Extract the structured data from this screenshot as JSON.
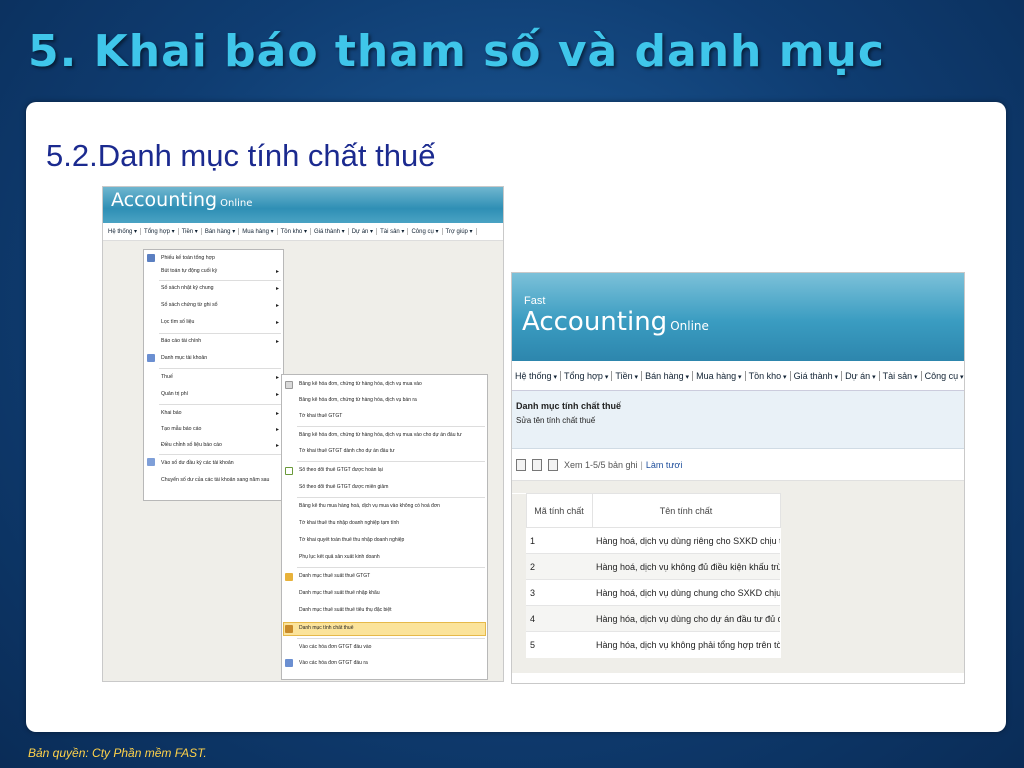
{
  "slide": {
    "title": "5. Khai báo tham số và danh mục",
    "subtitle": "5.2.Danh mục tính chất thuế",
    "footer": "Bản quyền: Cty Phần mềm FAST."
  },
  "app": {
    "brand": "Accounting",
    "brand_suffix": "Online",
    "fast_label": "Fast"
  },
  "menu": {
    "items": [
      "Hệ thống",
      "Tổng hợp",
      "Tiền",
      "Bán hàng",
      "Mua hàng",
      "Tồn kho",
      "Giá thành",
      "Dự án",
      "Tài sản",
      "Công cụ",
      "Trợ giúp"
    ]
  },
  "submenu_tonghop": [
    "Phiếu kế toán tổng hợp",
    "Bút toán tự động cuối kỳ",
    "Sổ sách nhật ký chung",
    "Sổ sách chứng từ ghi sổ",
    "Lọc tìm số liệu",
    "Báo cáo tài chính",
    "Danh mục tài khoản",
    "Thuế",
    "Quản trị phí",
    "Khai báo",
    "Tạo mẫu báo cáo",
    "Điều chỉnh số liệu báo cáo",
    "Vào số dư đầu kỳ các tài khoản",
    "Chuyển số dư của các tài khoản sang năm sau"
  ],
  "submenu_thue": [
    "Bảng kê hóa đơn, chứng từ hàng hóa, dịch vụ mua vào",
    "Bảng kê hóa đơn, chứng từ hàng hóa, dịch vụ bán ra",
    "Tờ khai thuế GTGT",
    "Bảng kê hóa đơn, chứng từ hàng hóa, dịch vụ mua vào cho dự án đầu tư",
    "Tờ khai thuế GTGT dành cho dự án đầu tư",
    "Sổ theo dõi thuế GTGT được hoàn lại",
    "Sổ theo dõi thuế GTGT được miễn giảm",
    "Bảng kê thu mua hàng hoá, dịch vụ mua vào không có hoá đơn",
    "Tờ khai thuế thu nhập doanh nghiệp tạm tính",
    "Tờ khai quyết toán thuế thu nhập doanh nghiệp",
    "Phụ lục kết quả sản xuất kinh doanh",
    "Danh mục thuế suất thuế GTGT",
    "Danh mục thuế suất thuế nhập khẩu",
    "Danh mục thuế suất thuế tiêu thụ đặc biệt",
    "Danh mục tính chất thuế",
    "Vào các hóa đơn GTGT đầu vào",
    "Vào các hóa đơn GTGT đầu ra"
  ],
  "panel": {
    "heading": "Danh mục tính chất thuế",
    "subheading": "Sửa tên tính chất thuế"
  },
  "toolbar": {
    "view_text": "Xem 1-5/5 bản ghi",
    "refresh": "Làm tươi"
  },
  "grid": {
    "headers": [
      "Mã tính chất",
      "Tên tính chất"
    ],
    "rows": [
      [
        "1",
        "Hàng hoá, dịch vụ dùng riêng cho SXKD chịu thuế G"
      ],
      [
        "2",
        "Hàng hoá, dịch vụ không đủ điều kiện khấu trừ"
      ],
      [
        "3",
        "Hàng hoá, dịch vụ dùng chung cho SXKD chịu thuế v"
      ],
      [
        "4",
        "Hàng hóa, dịch vụ dùng cho dự án đầu tư đủ điều kiệ"
      ],
      [
        "5",
        "Hàng hóa, dịch vụ không phải tổng hợp trên tờ khai"
      ]
    ]
  },
  "colors": {
    "title": "#3fc6ea",
    "subtitle": "#1b2a8f",
    "footer": "#ffd24a",
    "highlight": "#fbe39a"
  }
}
